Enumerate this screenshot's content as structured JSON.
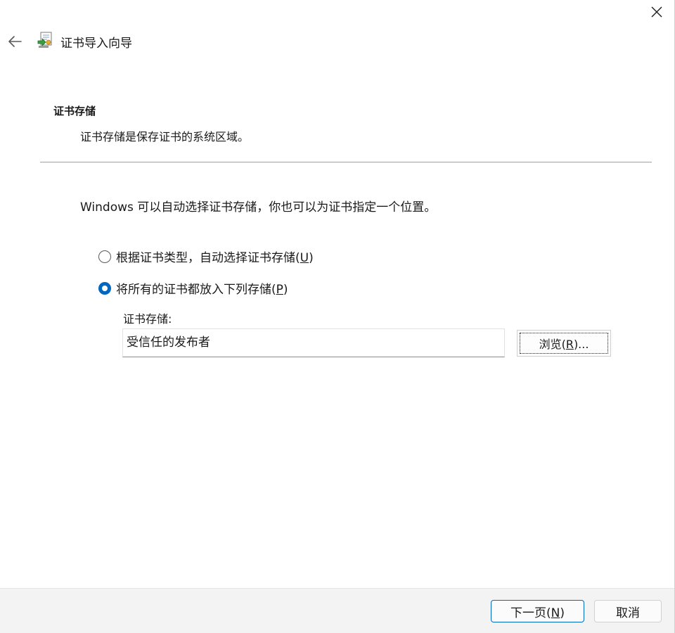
{
  "window": {
    "title": "证书导入向导"
  },
  "section": {
    "title": "证书存储",
    "description": "证书存储是保存证书的系统区域。"
  },
  "intro": "Windows 可以自动选择证书存储，你也可以为证书指定一个位置。",
  "options": {
    "auto": {
      "label": "根据证书类型，自动选择证书存储(",
      "mnemonic": "U",
      "suffix": ")",
      "checked": false
    },
    "manual": {
      "label": "将所有的证书都放入下列存储(",
      "mnemonic": "P",
      "suffix": ")",
      "checked": true
    }
  },
  "store": {
    "label": "证书存储:",
    "value": "受信任的发布者",
    "browse": {
      "label": "浏览(",
      "mnemonic": "R",
      "suffix": ")..."
    }
  },
  "footer": {
    "next": {
      "label": "下一页(",
      "mnemonic": "N",
      "suffix": ")"
    },
    "cancel": "取消"
  },
  "colors": {
    "accent": "#0067c0",
    "footer_bg": "#f3f3f3",
    "divider": "#a0a0a0"
  },
  "icons": {
    "close": "close-icon",
    "back": "back-arrow-icon",
    "wizard": "certificate-wizard-icon"
  }
}
